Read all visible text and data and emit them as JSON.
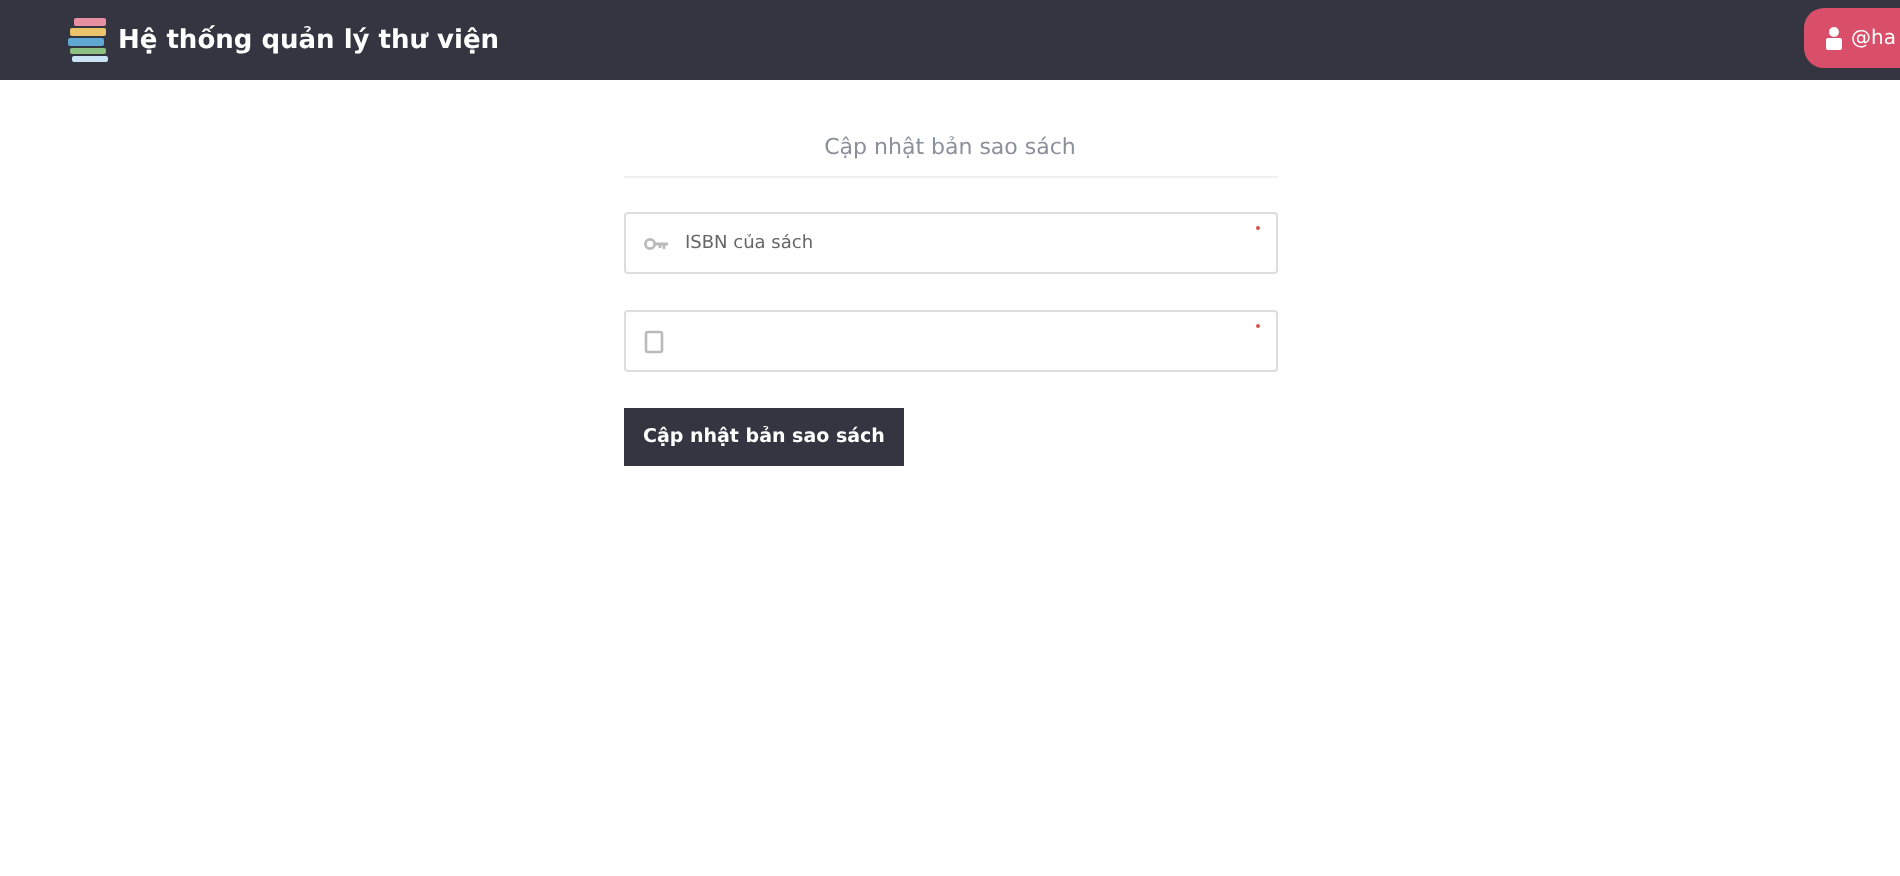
{
  "header": {
    "title": "Hệ thống quản lý thư viện",
    "user_badge": "@ha"
  },
  "form": {
    "title": "Cập nhật bản sao sách",
    "fields": [
      {
        "kind": "key",
        "placeholder": "ISBN của sách",
        "required": true
      },
      {
        "kind": "copy",
        "required": true
      }
    ],
    "submit": "Cập nhật bản sao sách"
  }
}
